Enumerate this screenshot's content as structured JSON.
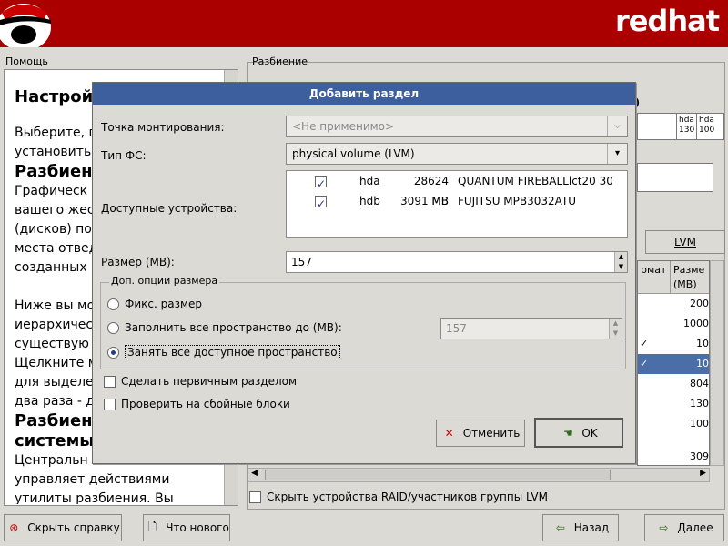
{
  "banner": {
    "brand": "redhat"
  },
  "help": {
    "label": "Помощь",
    "title": "Настрой",
    "lines": [
      "Выберите, г",
      "установить"
    ],
    "h_partition": "Разбиени",
    "para1": [
      "Графическ",
      "вашего жес",
      "(дисков) по",
      "места отвед",
      "созданных"
    ],
    "para2": [
      "Ниже вы мо",
      "иерархичес",
      "существую",
      "Щелкните м",
      "для выделе",
      "два раза - д"
    ],
    "h_system": [
      "Разбиени",
      "системы"
    ],
    "para3": [
      "Центральн",
      "управляет действиями",
      "утилиты разбиения. Вы"
    ]
  },
  "partition": {
    "label": "Разбиение",
    "disk_header_fragment": ")",
    "disk_segments": [
      "hda 130",
      "hda 100"
    ],
    "lvm_button": "LVM",
    "table_headers": [
      "рмат",
      "Разме (MB)"
    ],
    "table_values": [
      "200",
      "1000",
      "10",
      "10",
      "804",
      "130",
      "100",
      "309"
    ],
    "raid_checkbox": "Скрыть устройства RAID/участников группы LVM"
  },
  "dialog": {
    "title": "Добавить раздел",
    "mount_label": "Точка монтирования:",
    "mount_value": "<Не применимо>",
    "fstype_label": "Тип ФС:",
    "fstype_value": "physical volume (LVM)",
    "devices_label": "Доступные устройства:",
    "devices": [
      {
        "checked": true,
        "name": "hda",
        "size": "28624 MB",
        "model": "QUANTUM FIREBALLlct20 30"
      },
      {
        "checked": true,
        "name": "hdb",
        "size": "3091 MB",
        "model": "FUJITSU MPB3032ATU"
      }
    ],
    "size_label": "Размер (MB):",
    "size_value": "157",
    "options_title": "Доп. опции размера",
    "opt_fixed": "Фикс. размер",
    "opt_fill_upto": "Заполнить все пространство до (MB):",
    "opt_fill_upto_value": "157",
    "opt_fill_all": "Занять все доступное пространство",
    "selected_option": "fill_all",
    "primary_checkbox": "Сделать первичным разделом",
    "badblocks_checkbox": "Проверить на сбойные блоки",
    "cancel_button": "Отменить",
    "ok_button": "OK"
  },
  "bottom": {
    "hide_help": "Скрыть справку",
    "whats_new": "Что нового",
    "back": "Назад",
    "next": "Далее"
  }
}
